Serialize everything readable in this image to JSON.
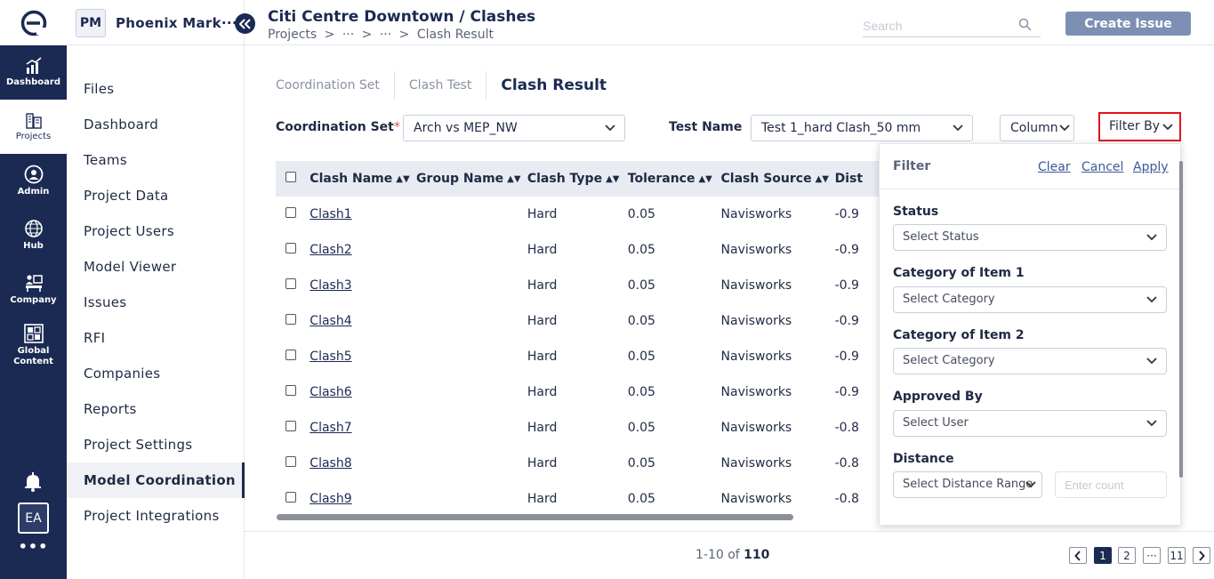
{
  "rail": {
    "items": [
      {
        "label": "Dashboard",
        "icon": "chart-icon"
      },
      {
        "label": "Projects",
        "icon": "building-icon"
      },
      {
        "label": "Admin",
        "icon": "admin-icon"
      },
      {
        "label": "Hub",
        "icon": "globe-icon"
      },
      {
        "label": "Company",
        "icon": "company-icon"
      },
      {
        "label": "Global Content",
        "icon": "grid-icon"
      }
    ],
    "avatar": "EA",
    "more": "•••"
  },
  "sidebar": {
    "badge": "PM",
    "project_name": "Phoenix Mark···",
    "items": [
      {
        "label": "Files"
      },
      {
        "label": "Dashboard"
      },
      {
        "label": "Teams"
      },
      {
        "label": "Project Data"
      },
      {
        "label": "Project Users"
      },
      {
        "label": "Model Viewer"
      },
      {
        "label": "Issues"
      },
      {
        "label": "RFI"
      },
      {
        "label": "Companies"
      },
      {
        "label": "Reports"
      },
      {
        "label": "Project Settings"
      },
      {
        "label": "Model Coordination"
      },
      {
        "label": "Project Integrations"
      }
    ]
  },
  "header": {
    "title": "Citi Centre Downtown / Clashes",
    "breadcrumb": [
      "Projects",
      ">",
      "···",
      ">",
      "···",
      ">",
      "Clash Result"
    ],
    "search_placeholder": "Search",
    "create_label": "Create Issue"
  },
  "tabs": [
    "Coordination Set",
    "Clash Test",
    "Clash Result"
  ],
  "filters": {
    "coordination_label": "Coordination Set",
    "coordination_required": "*",
    "coordination_value": "Arch vs MEP_NW",
    "test_label": "Test Name",
    "test_value": "Test 1_hard Clash_50 mm",
    "column_label": "Column",
    "filter_by_label": "Filter By"
  },
  "table": {
    "columns": [
      "Clash Name",
      "Group Name",
      "Clash Type",
      "Tolerance",
      "Clash Source",
      "Dist"
    ],
    "rows": [
      {
        "name": "Clash1",
        "group": "",
        "type": "Hard",
        "tolerance": "0.05",
        "source": "Navisworks",
        "distance": "-0.9"
      },
      {
        "name": "Clash2",
        "group": "",
        "type": "Hard",
        "tolerance": "0.05",
        "source": "Navisworks",
        "distance": "-0.9"
      },
      {
        "name": "Clash3",
        "group": "",
        "type": "Hard",
        "tolerance": "0.05",
        "source": "Navisworks",
        "distance": "-0.9"
      },
      {
        "name": "Clash4",
        "group": "",
        "type": "Hard",
        "tolerance": "0.05",
        "source": "Navisworks",
        "distance": "-0.9"
      },
      {
        "name": "Clash5",
        "group": "",
        "type": "Hard",
        "tolerance": "0.05",
        "source": "Navisworks",
        "distance": "-0.9"
      },
      {
        "name": "Clash6",
        "group": "",
        "type": "Hard",
        "tolerance": "0.05",
        "source": "Navisworks",
        "distance": "-0.9"
      },
      {
        "name": "Clash7",
        "group": "",
        "type": "Hard",
        "tolerance": "0.05",
        "source": "Navisworks",
        "distance": "-0.8"
      },
      {
        "name": "Clash8",
        "group": "",
        "type": "Hard",
        "tolerance": "0.05",
        "source": "Navisworks",
        "distance": "-0.8"
      },
      {
        "name": "Clash9",
        "group": "",
        "type": "Hard",
        "tolerance": "0.05",
        "source": "Navisworks",
        "distance": "-0.8"
      }
    ]
  },
  "filter_panel": {
    "title": "Filter",
    "clear": "Clear",
    "cancel": "Cancel",
    "apply": "Apply",
    "status_label": "Status",
    "status_placeholder": "Select Status",
    "cat1_label": "Category of Item 1",
    "cat1_placeholder": "Select Category",
    "cat2_label": "Category of Item 2",
    "cat2_placeholder": "Select Category",
    "approved_label": "Approved By",
    "approved_placeholder": "Select User",
    "distance_label": "Distance",
    "distance_placeholder": "Select Distance Range",
    "count_placeholder": "Enter count"
  },
  "pagination": {
    "range": "1-10 of",
    "total": "110",
    "pages": [
      "1",
      "2",
      "···",
      "11"
    ],
    "current": "1"
  },
  "colors": {
    "brand": "#1b2a52",
    "button": "#7d8fb3",
    "highlight": "#e0151b"
  }
}
